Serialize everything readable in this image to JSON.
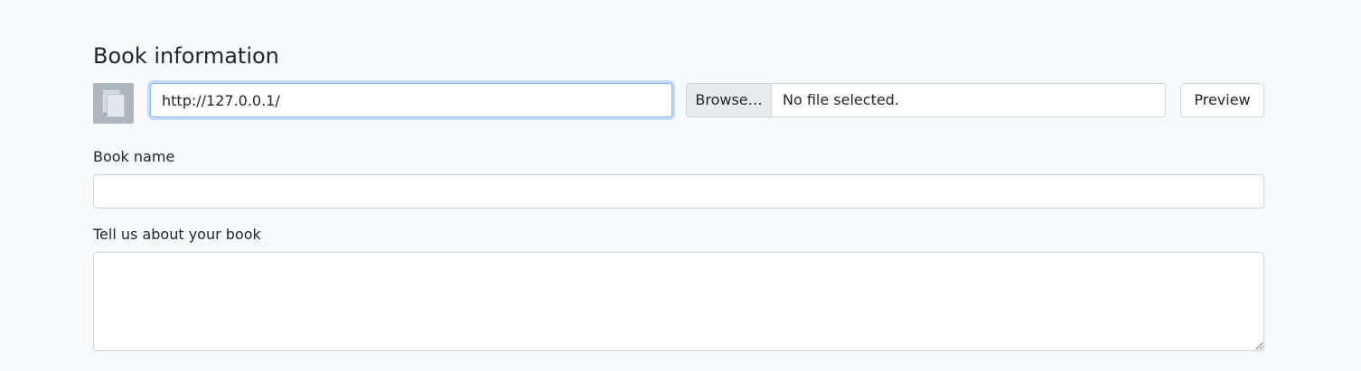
{
  "section": {
    "title": "Book information"
  },
  "cover": {
    "icon": "document-stack-icon",
    "url_value": "http://127.0.0.1/"
  },
  "file_upload": {
    "browse_label": "Browse…",
    "status_text": "No file selected."
  },
  "preview": {
    "label": "Preview"
  },
  "book_name": {
    "label": "Book name",
    "value": ""
  },
  "about": {
    "label": "Tell us about your book",
    "value": ""
  },
  "colors": {
    "background": "#f8f9fa",
    "focus_border": "#86b7fe",
    "border": "#ced4da",
    "browse_bg": "#e9ecef",
    "thumb_bg": "#adb5bd"
  }
}
